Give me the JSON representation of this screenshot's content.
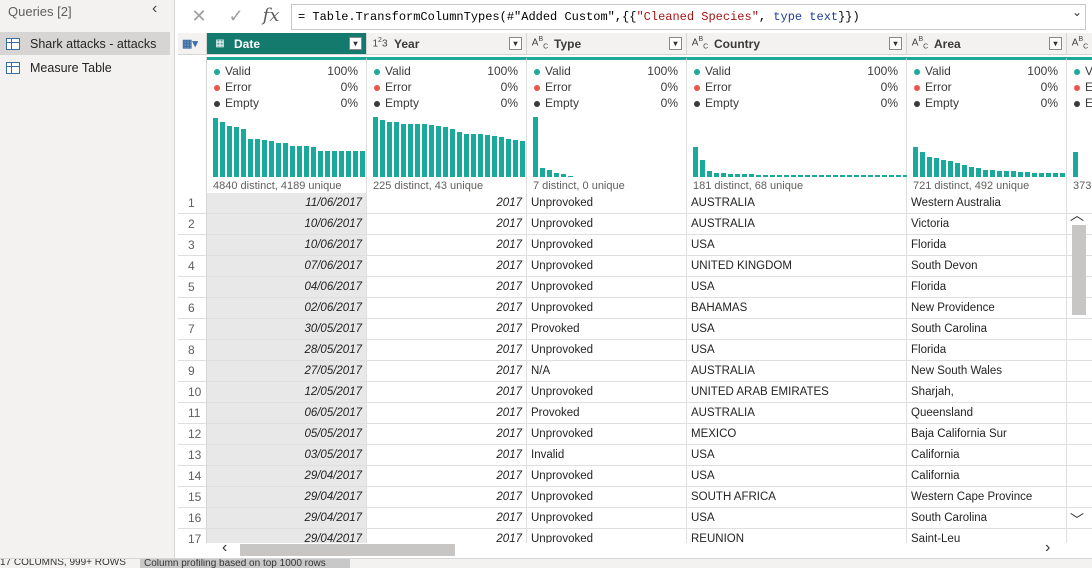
{
  "queries_pane": {
    "title": "Queries [2]",
    "items": [
      {
        "label": "Shark attacks - attacks",
        "selected": true
      },
      {
        "label": "Measure Table",
        "selected": false
      }
    ]
  },
  "formula_bar": {
    "cancel_icon": "close-icon",
    "commit_icon": "check-icon",
    "fx_label": "fx",
    "formula_prefix": "= Table.TransformColumnTypes(#\"Added Custom\",{{",
    "formula_string": "\"Cleaned Species\"",
    "formula_mid": ", ",
    "formula_keyword": "type text",
    "formula_suffix": "}})"
  },
  "columns": [
    {
      "name": "Date",
      "type_icon": "date",
      "selected": true
    },
    {
      "name": "Year",
      "type_icon": "123"
    },
    {
      "name": "Type",
      "type_icon": "ABC"
    },
    {
      "name": "Country",
      "type_icon": "ABC"
    },
    {
      "name": "Area",
      "type_icon": "ABC"
    },
    {
      "name": "",
      "type_icon": "ABC"
    }
  ],
  "profile_labels": {
    "valid": "Valid",
    "error": "Error",
    "empty": "Empty"
  },
  "profile_colors": {
    "valid": "#1aa99a",
    "error": "#e8564b",
    "empty": "#3b3a39"
  },
  "profiles": [
    {
      "valid": "100%",
      "error": "0%",
      "empty": "0%",
      "distinct": "4840 distinct, 4189 unique",
      "bars": [
        0.95,
        0.88,
        0.82,
        0.8,
        0.78,
        0.62,
        0.62,
        0.6,
        0.58,
        0.55,
        0.55,
        0.5,
        0.5,
        0.5,
        0.48,
        0.42,
        0.42,
        0.42,
        0.42,
        0.42,
        0.42,
        0.42,
        0.42
      ]
    },
    {
      "valid": "100%",
      "error": "0%",
      "empty": "0%",
      "distinct": "225 distinct, 43 unique",
      "bars": [
        0.96,
        0.92,
        0.88,
        0.88,
        0.86,
        0.86,
        0.86,
        0.86,
        0.84,
        0.82,
        0.8,
        0.78,
        0.72,
        0.7,
        0.7,
        0.7,
        0.68,
        0.66,
        0.64,
        0.62,
        0.6,
        0.58
      ]
    },
    {
      "valid": "100%",
      "error": "0%",
      "empty": "0%",
      "distinct": "7 distinct, 0 unique",
      "bars": [
        0.96,
        0.15,
        0.12,
        0.07,
        0.05,
        0.02
      ]
    },
    {
      "valid": "100%",
      "error": "0%",
      "empty": "0%",
      "distinct": "181 distinct, 68 unique",
      "bars": [
        0.48,
        0.28,
        0.09,
        0.06,
        0.06,
        0.05,
        0.05,
        0.05,
        0.05,
        0.04,
        0.04,
        0.04,
        0.04,
        0.04,
        0.04,
        0.04,
        0.04,
        0.04,
        0.04,
        0.04,
        0.04,
        0.04,
        0.04,
        0.04,
        0.04,
        0.04,
        0.04,
        0.04,
        0.04,
        0.04,
        0.04
      ]
    },
    {
      "valid": "100%",
      "error": "0%",
      "empty": "0%",
      "distinct": "721 distinct, 492 unique",
      "bars": [
        0.48,
        0.4,
        0.32,
        0.3,
        0.28,
        0.25,
        0.22,
        0.2,
        0.16,
        0.14,
        0.12,
        0.11,
        0.1,
        0.1,
        0.09,
        0.08,
        0.08,
        0.07,
        0.07,
        0.07,
        0.07,
        0.06
      ]
    },
    {
      "valid": "",
      "error": "",
      "empty": "",
      "distinct": "373",
      "bars": [
        0.4
      ]
    }
  ],
  "rows": [
    {
      "n": "1",
      "date": "11/06/2017",
      "year": "2017",
      "type": "Unprovoked",
      "country": "AUSTRALIA",
      "area": "Western Australia"
    },
    {
      "n": "2",
      "date": "10/06/2017",
      "year": "2017",
      "type": "Unprovoked",
      "country": "AUSTRALIA",
      "area": "Victoria"
    },
    {
      "n": "3",
      "date": "10/06/2017",
      "year": "2017",
      "type": "Unprovoked",
      "country": "USA",
      "area": "Florida"
    },
    {
      "n": "4",
      "date": "07/06/2017",
      "year": "2017",
      "type": "Unprovoked",
      "country": "UNITED KINGDOM",
      "area": "South Devon"
    },
    {
      "n": "5",
      "date": "04/06/2017",
      "year": "2017",
      "type": "Unprovoked",
      "country": "USA",
      "area": "Florida"
    },
    {
      "n": "6",
      "date": "02/06/2017",
      "year": "2017",
      "type": "Unprovoked",
      "country": "BAHAMAS",
      "area": "New Providence"
    },
    {
      "n": "7",
      "date": "30/05/2017",
      "year": "2017",
      "type": "Provoked",
      "country": "USA",
      "area": "South Carolina"
    },
    {
      "n": "8",
      "date": "28/05/2017",
      "year": "2017",
      "type": "Unprovoked",
      "country": "USA",
      "area": "Florida"
    },
    {
      "n": "9",
      "date": "27/05/2017",
      "year": "2017",
      "type": "N/A",
      "country": "AUSTRALIA",
      "area": "New South Wales"
    },
    {
      "n": "10",
      "date": "12/05/2017",
      "year": "2017",
      "type": "Unprovoked",
      "country": "UNITED ARAB EMIRATES",
      "area": "Sharjah,"
    },
    {
      "n": "11",
      "date": "06/05/2017",
      "year": "2017",
      "type": "Provoked",
      "country": "AUSTRALIA",
      "area": "Queensland"
    },
    {
      "n": "12",
      "date": "05/05/2017",
      "year": "2017",
      "type": "Unprovoked",
      "country": "MEXICO",
      "area": "Baja California Sur"
    },
    {
      "n": "13",
      "date": "03/05/2017",
      "year": "2017",
      "type": "Invalid",
      "country": "USA",
      "area": "California"
    },
    {
      "n": "14",
      "date": "29/04/2017",
      "year": "2017",
      "type": "Unprovoked",
      "country": "USA",
      "area": "California"
    },
    {
      "n": "15",
      "date": "29/04/2017",
      "year": "2017",
      "type": "Unprovoked",
      "country": "SOUTH AFRICA",
      "area": "Western Cape Province"
    },
    {
      "n": "16",
      "date": "29/04/2017",
      "year": "2017",
      "type": "Unprovoked",
      "country": "USA",
      "area": "South Carolina"
    },
    {
      "n": "17",
      "date": "29/04/2017",
      "year": "2017",
      "type": "Unprovoked",
      "country": "REUNION",
      "area": "Saint-Leu"
    }
  ],
  "status_bar": {
    "summary": "17 COLUMNS, 999+ ROWS",
    "profiling_note": "Column profiling based on top 1000 rows"
  }
}
